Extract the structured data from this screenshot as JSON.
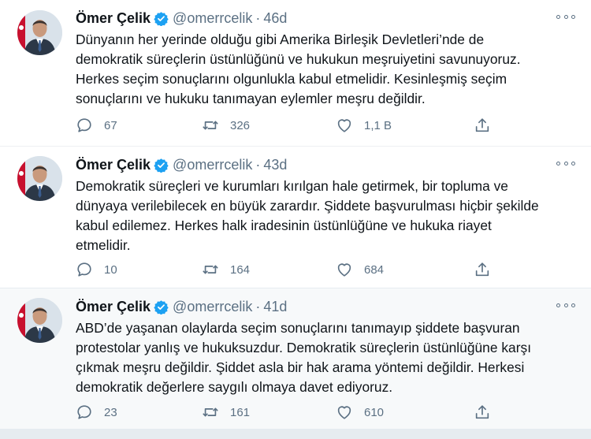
{
  "tweets": [
    {
      "author": {
        "name": "Ömer Çelik",
        "handle": "@omerrcelik"
      },
      "separator": "·",
      "time": "46d",
      "lines": [
        "Dünyanın her yerinde olduğu gibi Amerika Birleşik Devletleri’nde de",
        "demokratik süreçlerin üstünlüğünü ve hukukun meşruiyetini savunuyoruz.",
        "Herkes seçim sonuçlarını olgunlukla kabul etmelidir. Kesinleşmiş seçim",
        "sonuçlarını ve hukuku tanımayan eylemler meşru değildir."
      ],
      "stats": {
        "replies": "67",
        "retweets": "326",
        "likes": "1,1 B"
      }
    },
    {
      "author": {
        "name": "Ömer Çelik",
        "handle": "@omerrcelik"
      },
      "separator": "·",
      "time": "43d",
      "lines": [
        "Demokratik süreçleri ve kurumları kırılgan hale getirmek, bir topluma ve",
        "dünyaya verilebilecek en büyük zarardır. Şiddete başvurulması hiçbir şekilde",
        "kabul edilemez. Herkes halk iradesinin üstünlüğüne ve hukuka riayet",
        "etmelidir."
      ],
      "stats": {
        "replies": "10",
        "retweets": "164",
        "likes": "684"
      }
    },
    {
      "author": {
        "name": "Ömer Çelik",
        "handle": "@omerrcelik"
      },
      "separator": "·",
      "time": "41d",
      "lines": [
        "ABD’de yaşanan olaylarda seçim sonuçlarını tanımayıp şiddete başvuran",
        "protestolar yanlış ve hukuksuzdur. Demokratik süreçlerin üstünlüğüne karşı",
        "çıkmak meşru değildir. Şiddet asla bir hak arama yöntemi değildir. Herkesi",
        "demokratik değerlere saygılı olmaya davet ediyoruz."
      ],
      "stats": {
        "replies": "23",
        "retweets": "161",
        "likes": "610"
      }
    }
  ],
  "icons": {
    "verified": "verified-badge-icon",
    "more": "more-options-icon",
    "reply": "reply-icon",
    "retweet": "retweet-icon",
    "like": "heart-icon",
    "share": "share-icon"
  },
  "colors": {
    "accent": "#1da1f2",
    "text": "#0f1419",
    "secondary": "#5b7083",
    "highlight_background": "#f7f9fa"
  }
}
